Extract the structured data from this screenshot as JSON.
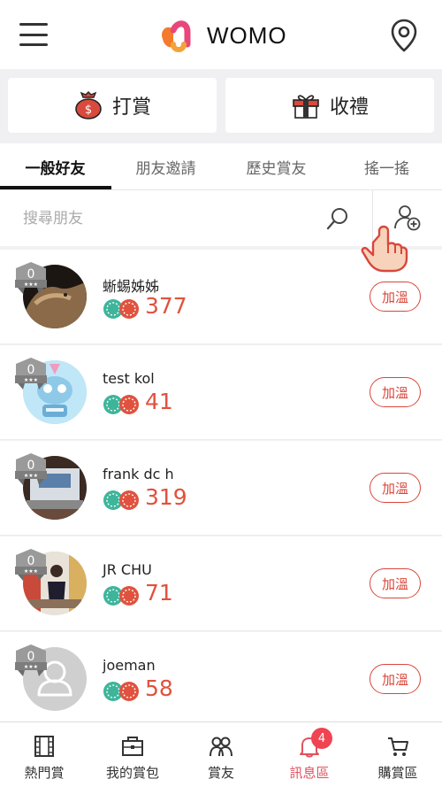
{
  "header": {
    "brand": "WOMO",
    "icons": {
      "menu": "hamburger-menu-icon",
      "location": "location-pin-icon"
    }
  },
  "actions": {
    "tip_label": "打賞",
    "gift_label": "收禮"
  },
  "tabs": [
    {
      "label": "一般好友",
      "active": true
    },
    {
      "label": "朋友邀請",
      "active": false
    },
    {
      "label": "歷史賞友",
      "active": false
    },
    {
      "label": "搖一搖",
      "active": false
    }
  ],
  "search": {
    "placeholder": "搜尋朋友"
  },
  "friends": [
    {
      "name": "蜥蜴姊姊",
      "rank": "0",
      "points": "377",
      "add_label": "加溫",
      "avatar": "lizard-photo"
    },
    {
      "name": "test kol",
      "rank": "0",
      "points": "41",
      "add_label": "加溫",
      "avatar": "robot-illustration"
    },
    {
      "name": "frank dc h",
      "rank": "0",
      "points": "319",
      "add_label": "加溫",
      "avatar": "laptop-photo"
    },
    {
      "name": "JR CHU",
      "rank": "0",
      "points": "71",
      "add_label": "加溫",
      "avatar": "street-photo"
    },
    {
      "name": "joeman",
      "rank": "0",
      "points": "58",
      "add_label": "加溫",
      "avatar": "default-avatar"
    }
  ],
  "bottom_nav": [
    {
      "label": "熱門賞",
      "icon": "film-icon",
      "active": false
    },
    {
      "label": "我的賞包",
      "icon": "wallet-icon",
      "active": false
    },
    {
      "label": "賞友",
      "icon": "friends-icon",
      "active": false
    },
    {
      "label": "訊息區",
      "icon": "bell-icon",
      "active": true,
      "badge": "4"
    },
    {
      "label": "購賞區",
      "icon": "cart-icon",
      "active": false
    }
  ],
  "colors": {
    "accent": "#e0523e",
    "badge": "#ef4452",
    "coin_green": "#3eb59a",
    "coin_red": "#e0523e"
  }
}
